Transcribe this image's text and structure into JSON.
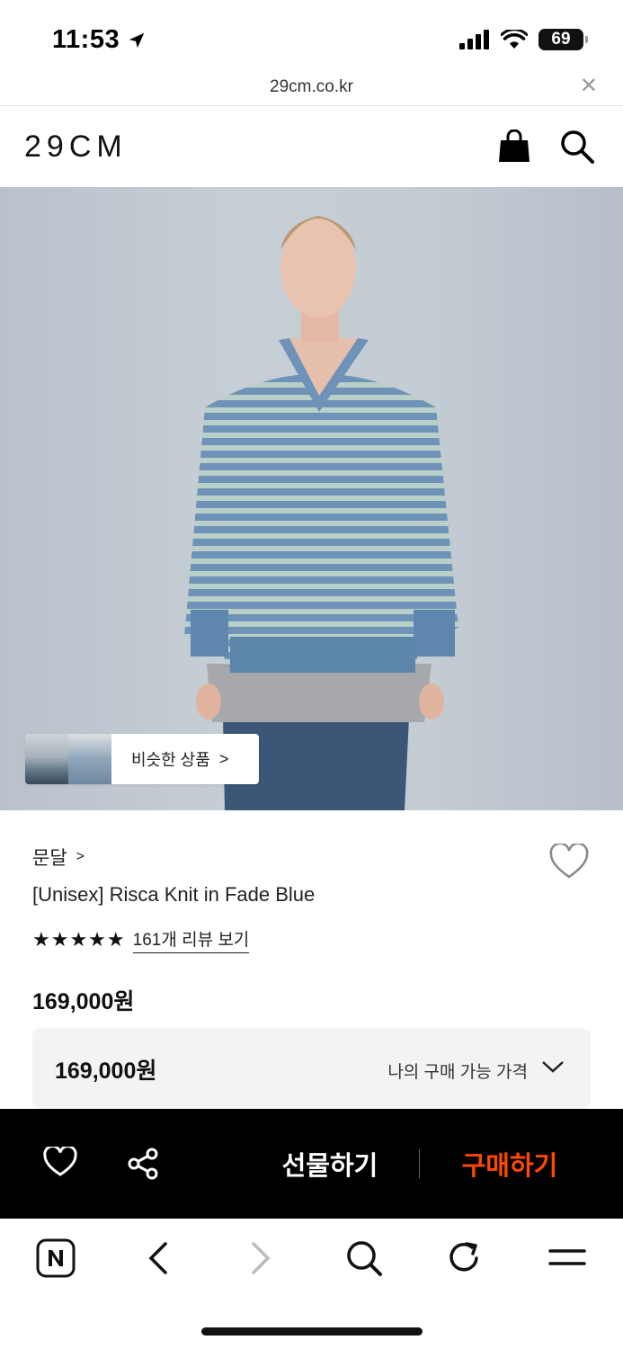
{
  "status_bar": {
    "time": "11:53",
    "battery": "69"
  },
  "browser": {
    "url": "29cm.co.kr",
    "close_icon": "close-icon"
  },
  "header": {
    "logo": "29CM",
    "icons": [
      "shopping-bag-icon",
      "search-icon"
    ]
  },
  "product": {
    "image_icon": "product-photo",
    "similar_products_label": "비슷한 상품",
    "similar_products_chevron": ">",
    "brand": "문달",
    "brand_chevron": ">",
    "name": "[Unisex] Risca Knit in Fade Blue",
    "rating_stars": 5,
    "stars_text": "★★★★★",
    "review_link": "161개 리뷰 보기",
    "price": "169,000원",
    "price_box": {
      "value": "169,000원",
      "label": "나의 구매 가능 가격"
    }
  },
  "action_bar": {
    "gift_label": "선물하기",
    "buy_label": "구매하기",
    "buy_color": "#ff4800"
  },
  "toolbar": {
    "icons": [
      "naver-icon",
      "back-icon",
      "forward-icon",
      "search-icon",
      "refresh-icon",
      "menu-icon"
    ]
  }
}
